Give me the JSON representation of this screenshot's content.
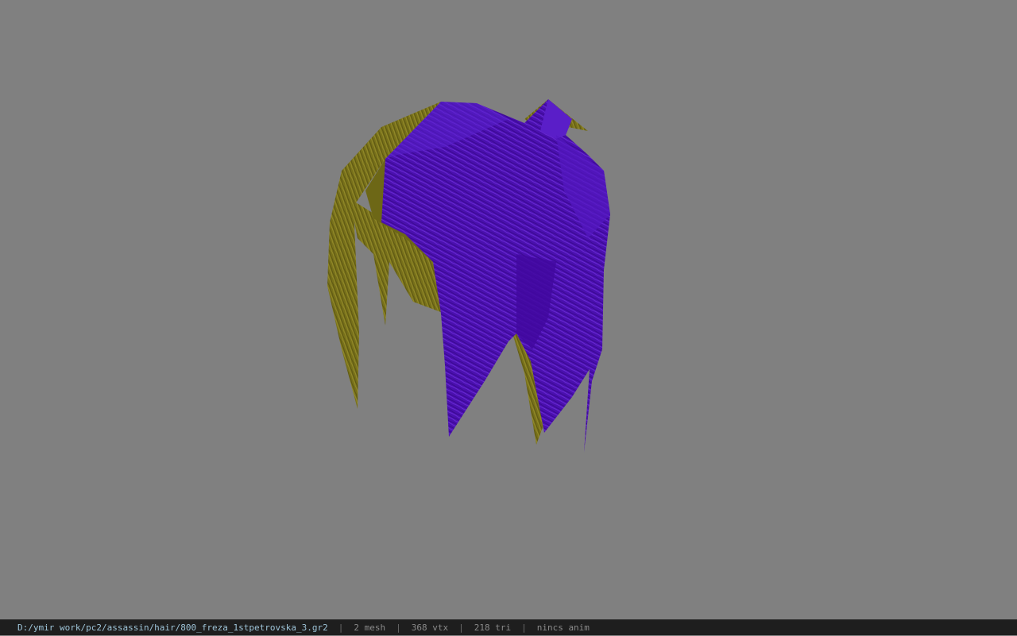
{
  "viewport": {
    "background_color": "#808080",
    "model": {
      "primary_color": "#4a0fb0",
      "secondary_color": "#7a7418"
    }
  },
  "statusbar": {
    "file_path": "D:/ymir work/pc2/assassin/hair/800_freza_1stpetrovska_3.gr2",
    "mesh_count": "2 mesh",
    "vertex_count": "368 vtx",
    "triangle_count": "218 tri",
    "anim_status": "nincs anim",
    "separator": "|"
  }
}
